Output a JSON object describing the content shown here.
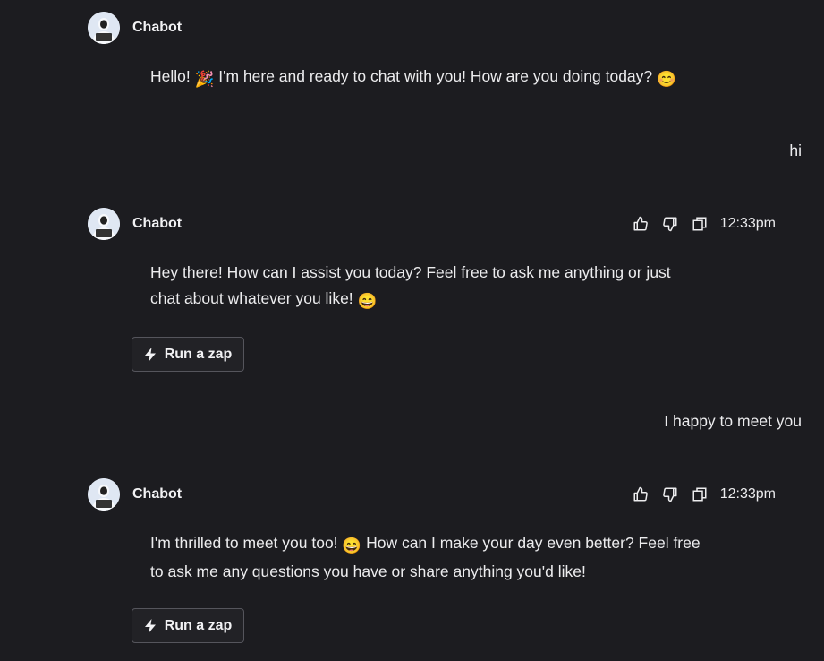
{
  "messages": [
    {
      "sender": "Chabot",
      "text_before_emoji": "Hello! ",
      "emoji_1": "🎉",
      "text_middle": " I'm here and ready to chat with you! How are you doing today? ",
      "emoji_2": "😊"
    },
    {
      "sender": "user",
      "text": "hi"
    },
    {
      "sender": "Chabot",
      "time": "12:33pm",
      "text_line_1": "Hey there! How can I assist you today? Feel free to ask me anything or just",
      "text_line_2": "chat about whatever you like! ",
      "emoji": "😄",
      "action_label": "Run a zap"
    },
    {
      "sender": "user",
      "text": "I happy to meet you"
    },
    {
      "sender": "Chabot",
      "time": "12:33pm",
      "text_line_1_a": "I'm thrilled to meet you too! ",
      "emoji": "😄",
      "text_line_1_b": " How can I make your day even better? Feel free",
      "text_line_2": "to ask me any questions you have or share anything you'd like!",
      "action_label": "Run a zap"
    }
  ],
  "icons": {
    "like": "thumbs-up-icon",
    "dislike": "thumbs-down-icon",
    "copy": "copy-icon",
    "zap": "lightning-icon"
  },
  "colors": {
    "background": "#1c1c20",
    "text": "#ececee",
    "button_border": "#55555c"
  }
}
